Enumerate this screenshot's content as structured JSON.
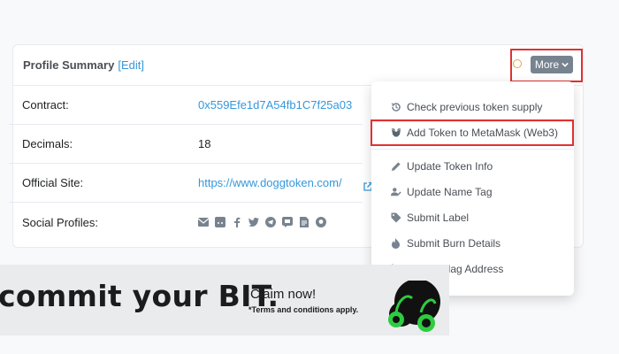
{
  "card": {
    "title": "Profile Summary",
    "edit_label": "[Edit]",
    "more_label": "More"
  },
  "rows": [
    {
      "label": "Contract:",
      "value": "0x559Efe1d7A54fb1C7f25a03"
    },
    {
      "label": "Decimals:",
      "value": "18"
    },
    {
      "label": "Official Site:",
      "value": "https://www.doggtoken.com/"
    },
    {
      "label": "Social Profiles:",
      "value": ""
    }
  ],
  "social_icons": [
    "email-icon",
    "reddit-icon",
    "facebook-icon",
    "twitter-icon",
    "telegram-icon",
    "discord-icon",
    "document-icon",
    "github-icon"
  ],
  "menu": {
    "items": [
      {
        "label": "Check previous token supply",
        "icon": "history-icon"
      },
      {
        "label": "Add Token to MetaMask (Web3)",
        "icon": "metamask-icon"
      },
      {
        "label": "Update Token Info",
        "icon": "pencil-icon"
      },
      {
        "label": "Update Name Tag",
        "icon": "user-edit-icon"
      },
      {
        "label": "Submit Label",
        "icon": "tag-icon"
      },
      {
        "label": "Submit Burn Details",
        "icon": "fire-icon"
      },
      {
        "label": "Report/Flag Address",
        "icon": "flag-icon"
      }
    ]
  },
  "banner": {
    "headline": "commit your BIT.",
    "cta": "Claim now!",
    "terms": "*Terms and conditions apply."
  },
  "colors": {
    "link": "#3498db",
    "highlight": "#e03131",
    "more_button": "#77838f",
    "banner_accent": "#2ecc40"
  }
}
